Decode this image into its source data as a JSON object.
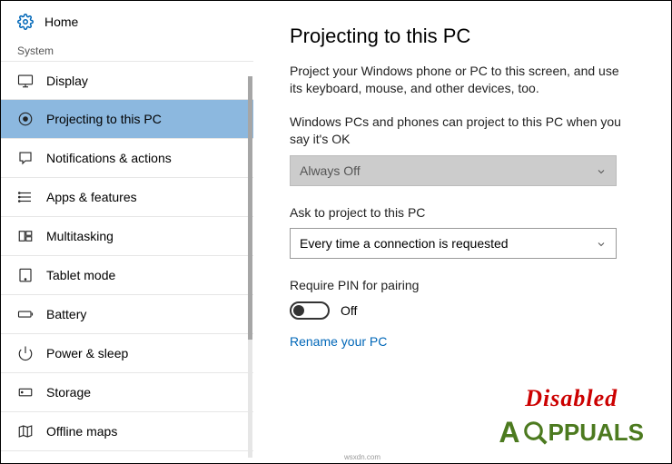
{
  "home_label": "Home",
  "section_label": "System",
  "nav_items": [
    {
      "label": "Display"
    },
    {
      "label": "Projecting to this PC"
    },
    {
      "label": "Notifications & actions"
    },
    {
      "label": "Apps & features"
    },
    {
      "label": "Multitasking"
    },
    {
      "label": "Tablet mode"
    },
    {
      "label": "Battery"
    },
    {
      "label": "Power & sleep"
    },
    {
      "label": "Storage"
    },
    {
      "label": "Offline maps"
    }
  ],
  "page_title": "Projecting to this PC",
  "description": "Project your Windows phone or PC to this screen, and use its keyboard, mouse, and other devices, too.",
  "field1_label": "Windows PCs and phones can project to this PC when you say it's OK",
  "field1_value": "Always Off",
  "field2_label": "Ask to project to this PC",
  "field2_value": "Every time a connection is requested",
  "field3_label": "Require PIN for pairing",
  "toggle_state": "Off",
  "link_text": "Rename your PC",
  "overlay_text": "Disabled",
  "logo_text": "PPUALS",
  "credit": "wsxdn.com"
}
